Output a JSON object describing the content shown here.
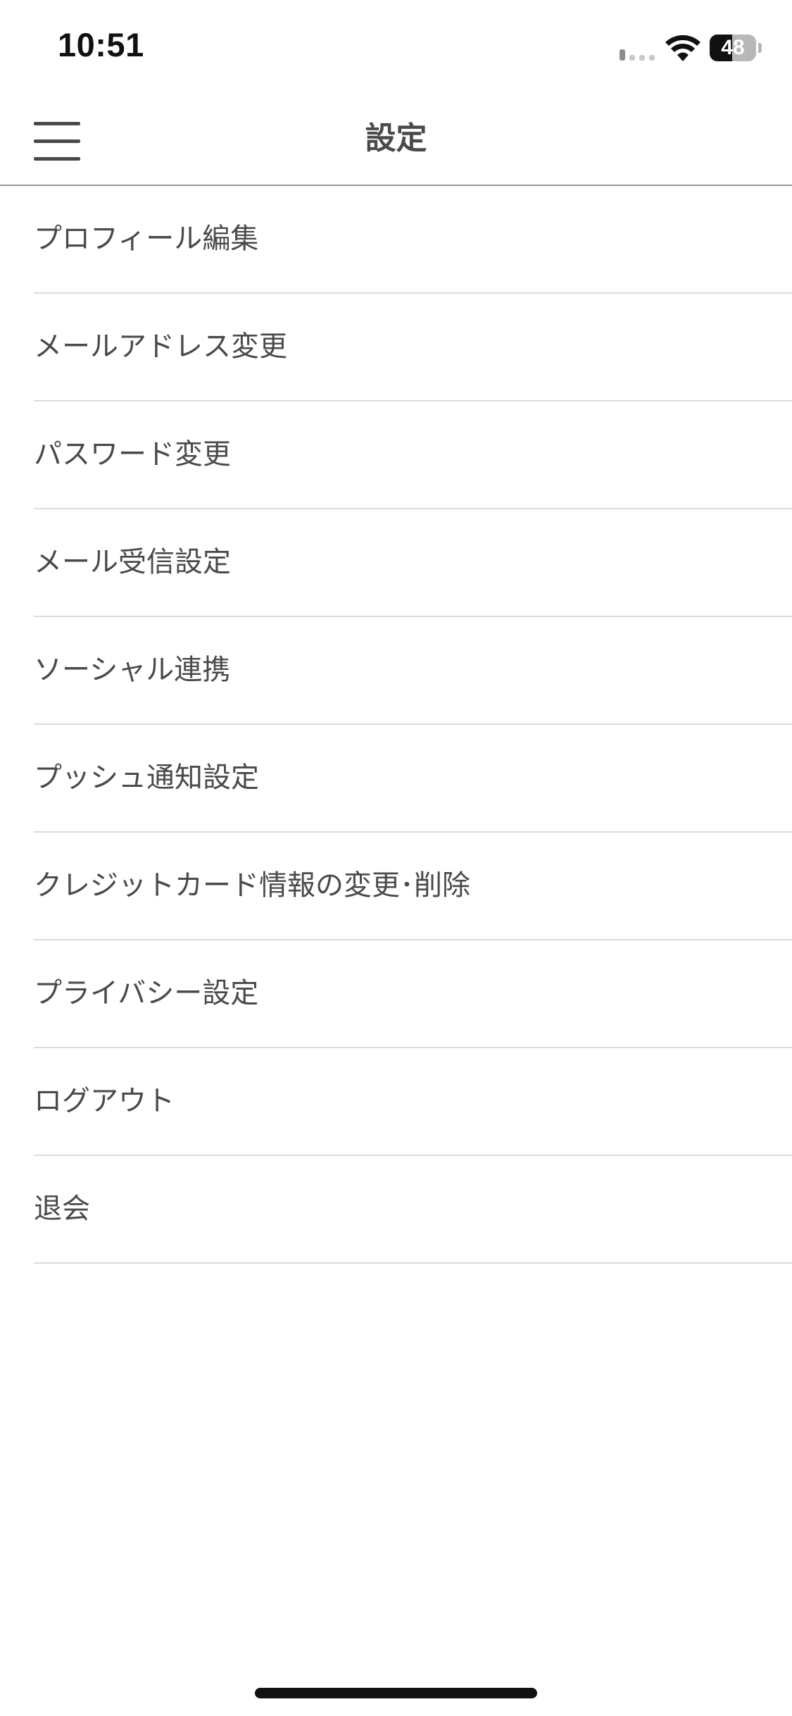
{
  "status_bar": {
    "time": "10:51",
    "battery_percent": "48",
    "battery_level": 0.48,
    "signal_icon": "cellular-signal-icon",
    "wifi_icon": "wifi-icon",
    "battery_icon": "battery-icon"
  },
  "header": {
    "title": "設定",
    "menu_icon": "hamburger-menu-icon"
  },
  "settings": {
    "items": [
      {
        "label": "プロフィール編集"
      },
      {
        "label": "メールアドレス変更"
      },
      {
        "label": "パスワード変更"
      },
      {
        "label": "メール受信設定"
      },
      {
        "label": "ソーシャル連携"
      },
      {
        "label": "プッシュ通知設定"
      },
      {
        "label": "クレジットカード情報の変更･削除"
      },
      {
        "label": "プライバシー設定"
      },
      {
        "label": "ログアウト"
      },
      {
        "label": "退会"
      }
    ]
  },
  "colors": {
    "text": "#4a4a4a",
    "divider": "#dcdcdc",
    "header_border": "#9a9a9a",
    "background": "#ffffff"
  }
}
